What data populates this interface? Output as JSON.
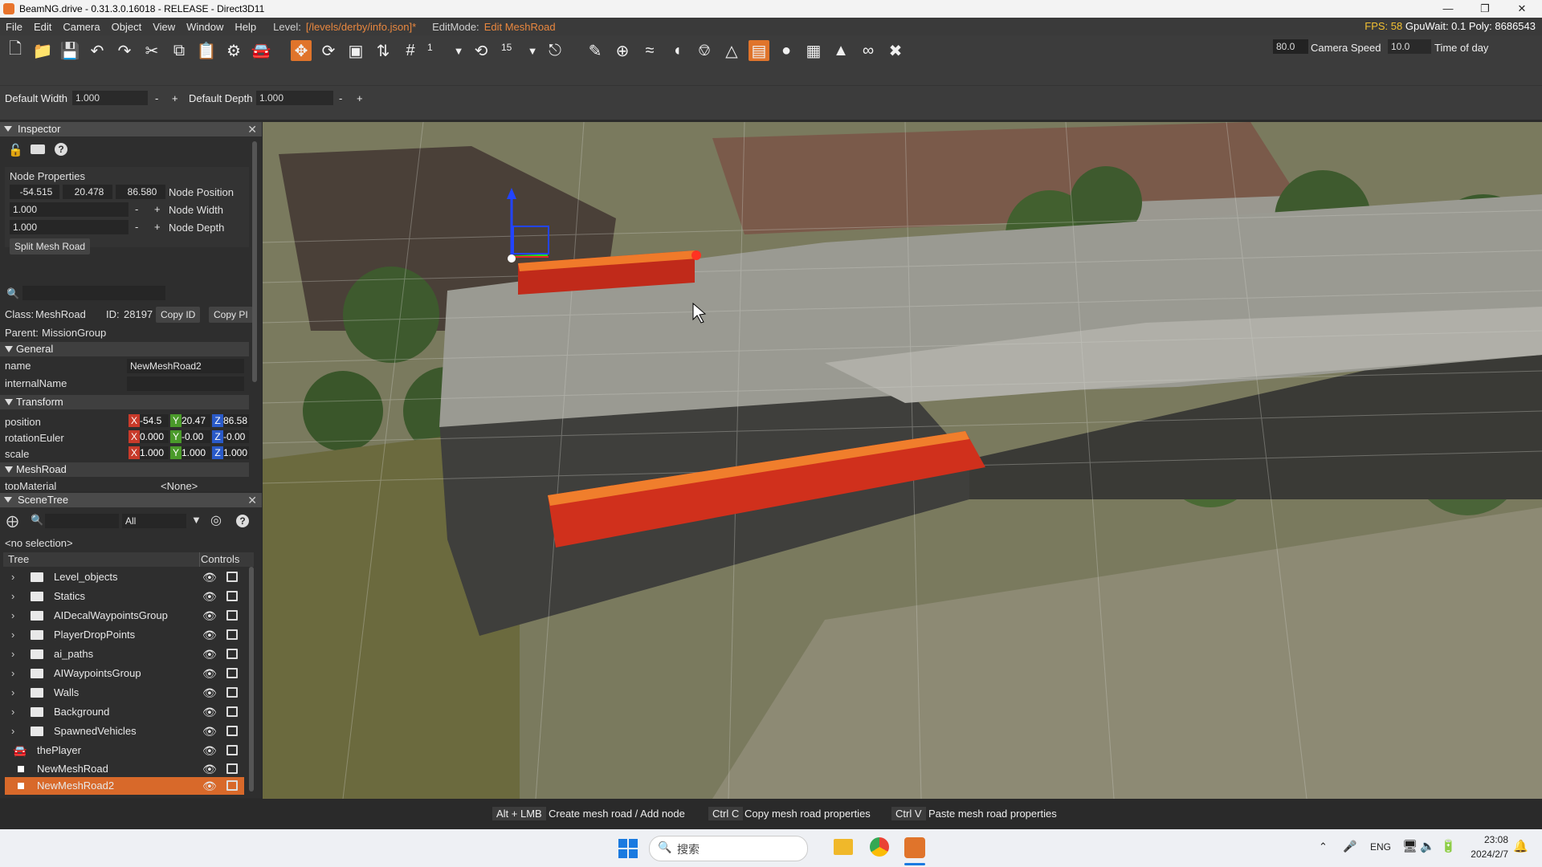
{
  "window": {
    "title": "BeamNG.drive - 0.31.3.0.16018 - RELEASE - Direct3D11"
  },
  "menu": {
    "items": [
      "File",
      "Edit",
      "Camera",
      "Object",
      "View",
      "Window",
      "Help"
    ],
    "level_label": "Level:",
    "level_value": "[/levels/derby/info.json]*",
    "editmode_label": "EditMode:",
    "editmode_value": "Edit MeshRoad",
    "fps": "FPS: 58",
    "gpuwait": "GpuWait: 0.1",
    "poly": "Poly: 8686543"
  },
  "toolbar": {
    "snap_value": "1",
    "rotate_value": "15",
    "field_left": "80.0",
    "camera_speed_label": "Camera Speed",
    "camera_speed_value": "10.0",
    "time_of_day_label": "Time of day"
  },
  "toolbar2": {
    "default_width_label": "Default Width",
    "default_width_value": "1.000",
    "default_depth_label": "Default Depth",
    "default_depth_value": "1.000",
    "minus": "-",
    "plus": "+"
  },
  "inspector": {
    "title": "Inspector",
    "node_properties": "Node Properties",
    "pos_x": "-54.515",
    "pos_y": "20.478",
    "pos_z": "86.580",
    "node_position": "Node Position",
    "width_value": "1.000",
    "node_width": "Node Width",
    "depth_value": "1.000",
    "node_depth": "Node Depth",
    "split_button": "Split Mesh Road",
    "class_label": "Class:",
    "class_value": "MeshRoad",
    "id_label": "ID:",
    "id_value": "28197",
    "copy_id": "Copy ID",
    "copy_pi": "Copy PI",
    "parent_label": "Parent:",
    "parent_value": "MissionGroup",
    "general": "General",
    "name_label": "name",
    "name_value": "NewMeshRoad2",
    "internal_name_label": "internalName",
    "transform": "Transform",
    "position_label": "position",
    "position": [
      "-54.5",
      "20.47",
      "86.58"
    ],
    "rotation_label": "rotationEuler",
    "rotation": [
      "0.000",
      "-0.00",
      "-0.00"
    ],
    "scale_label": "scale",
    "scale": [
      "1.000",
      "1.000",
      "1.000"
    ],
    "meshroad": "MeshRoad",
    "topmaterial_label": "topMaterial",
    "topmaterial_value": "<None>"
  },
  "scenetree": {
    "title": "SceneTree",
    "filter": "All",
    "no_selection": "<no selection>",
    "col_tree": "Tree",
    "col_controls": "Controls",
    "folders": [
      "Level_objects",
      "Statics",
      "AIDecalWaypointsGroup",
      "PlayerDropPoints",
      "ai_paths",
      "AIWaypointsGroup",
      "Walls",
      "Background",
      "SpawnedVehicles"
    ],
    "player": "thePlayer",
    "roads": [
      "NewMeshRoad",
      "NewMeshRoad2"
    ]
  },
  "statusbar": {
    "k1": "Alt + LMB",
    "d1": "Create mesh road / Add node",
    "k2": "Ctrl C",
    "d2": "Copy mesh road properties",
    "k3": "Ctrl V",
    "d3": "Paste mesh road properties"
  },
  "taskbar": {
    "search_placeholder": "搜索",
    "lang": "ENG",
    "time": "23:08",
    "date": "2024/2/7"
  },
  "colors": {
    "accent": "#e0742b",
    "selected_row": "#d8692a"
  }
}
